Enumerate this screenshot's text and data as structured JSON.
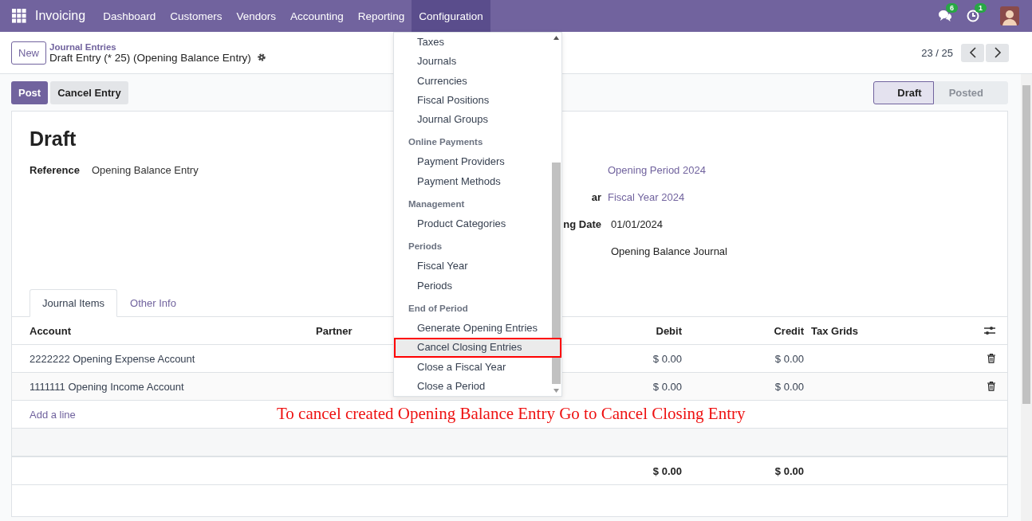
{
  "navbar": {
    "app": "Invoicing",
    "menu": [
      {
        "label": "Dashboard",
        "selected": false
      },
      {
        "label": "Customers",
        "selected": false
      },
      {
        "label": "Vendors",
        "selected": false
      },
      {
        "label": "Accounting",
        "selected": false
      },
      {
        "label": "Reporting",
        "selected": false
      },
      {
        "label": "Configuration",
        "selected": true
      }
    ],
    "messages_badge": "6",
    "activities_badge": "1"
  },
  "breadcrumb": {
    "new_button": "New",
    "parent": "Journal Entries",
    "current": "Draft Entry (* 25) (Opening Balance Entry)"
  },
  "pager": {
    "value": "23 / 25"
  },
  "actions": [
    {
      "label": "Post",
      "kind": "primary"
    },
    {
      "label": "Cancel Entry",
      "kind": "secondary"
    }
  ],
  "statusbar": [
    {
      "label": "Draft",
      "selected": true
    },
    {
      "label": "Posted",
      "selected": false
    }
  ],
  "form": {
    "title": "Draft",
    "left_fields": [
      {
        "label": "Reference",
        "value": "Opening Balance Entry"
      }
    ],
    "right_fields": [
      {
        "value": "Opening Period 2024",
        "kind": "link"
      },
      {
        "label": "ar",
        "value": "Fiscal Year 2024",
        "kind": "link"
      },
      {
        "label": "ng Date",
        "value": "01/01/2024",
        "kind": "input"
      },
      {
        "value": "Opening Balance Journal",
        "kind": "input"
      }
    ]
  },
  "tabs": [
    {
      "label": "Journal Items",
      "selected": true
    },
    {
      "label": "Other Info",
      "selected": false
    }
  ],
  "table": {
    "columns": [
      "Account",
      "Partner",
      "Debit",
      "Credit",
      "Tax Grids"
    ],
    "rows": [
      {
        "account": "2222222 Opening Expense Account",
        "debit": "$ 0.00",
        "credit": "$ 0.00"
      },
      {
        "account": "1111111 Opening Income Account",
        "debit": "$ 0.00",
        "credit": "$ 0.00"
      }
    ],
    "add_line": "Add a line",
    "totals": {
      "debit": "$ 0.00",
      "credit": "$ 0.00"
    }
  },
  "dropdown": {
    "sections": [
      {
        "items": [
          {
            "label": "Taxes",
            "selected": false
          },
          {
            "label": "Journals",
            "selected": false
          },
          {
            "label": "Currencies",
            "selected": false
          },
          {
            "label": "Fiscal Positions",
            "selected": false
          },
          {
            "label": "Journal Groups",
            "selected": false
          }
        ]
      },
      {
        "title": "Online Payments",
        "items": [
          {
            "label": "Payment Providers",
            "selected": false
          },
          {
            "label": "Payment Methods",
            "selected": false
          }
        ]
      },
      {
        "title": "Management",
        "items": [
          {
            "label": "Product Categories",
            "selected": false
          }
        ]
      },
      {
        "title": "Periods",
        "items": [
          {
            "label": "Fiscal Year",
            "selected": false
          },
          {
            "label": "Periods",
            "selected": false
          }
        ]
      },
      {
        "title": "End of Period",
        "items": [
          {
            "label": "Generate Opening Entries",
            "selected": false
          },
          {
            "label": "Cancel Closing Entries",
            "selected": true
          },
          {
            "label": "Close a Fiscal Year",
            "selected": false
          },
          {
            "label": "Close a Period",
            "selected": false
          }
        ]
      }
    ]
  },
  "annotation": "To cancel created Opening Balance Entry Go to Cancel Closing Entry"
}
